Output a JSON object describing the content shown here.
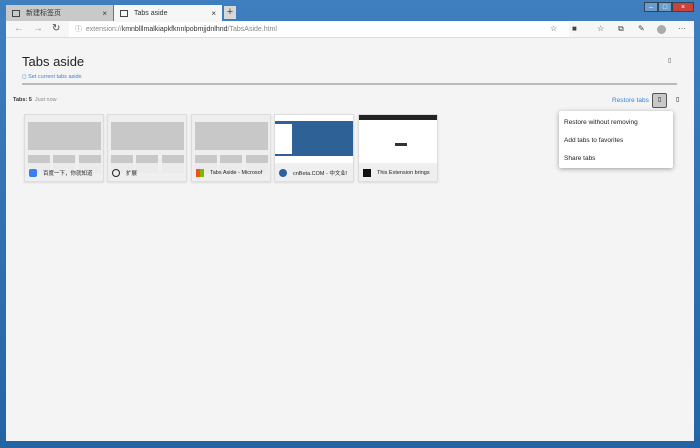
{
  "browser": {
    "tabs": [
      {
        "label": "新建标签页",
        "icon": "newtab-icon"
      },
      {
        "label": "Tabs aside",
        "icon": "tabs-icon"
      }
    ],
    "new_tab": "+",
    "close_glyph": "×",
    "address": {
      "prefix": "extension://",
      "host": "kmnblllmalkiapkfknnlpobmjjdnlhnd",
      "path": "/TabsAside.html"
    },
    "window_buttons": [
      "–",
      "□",
      "×"
    ]
  },
  "page": {
    "title": "Tabs aside",
    "set_aside": "◻ Set current tabs aside",
    "top_icon": "▯",
    "collection": {
      "count_label": "Tabs: 5",
      "time": "Just now",
      "restore": "Restore tabs",
      "more_icon": "▯",
      "delete_icon": "▯",
      "tabs": [
        {
          "title": "百度一下，你就知道",
          "favicon": "baidu-icon",
          "color": "#3b7df0"
        },
        {
          "title": "扩展",
          "favicon": "globe-icon",
          "color": "#222222"
        },
        {
          "title": "Tabs Aside - Microsof",
          "favicon": "microsoft-icon",
          "color": "#f25022"
        },
        {
          "title": "cnBeta.COM - 中文业!",
          "favicon": "cnbeta-icon",
          "color": "#2f5f9f"
        },
        {
          "title": "This Extension brings",
          "favicon": "td-icon",
          "color": "#111111"
        }
      ]
    },
    "menu": [
      "Restore without removing",
      "Add tabs to favorites",
      "Share tabs"
    ]
  }
}
